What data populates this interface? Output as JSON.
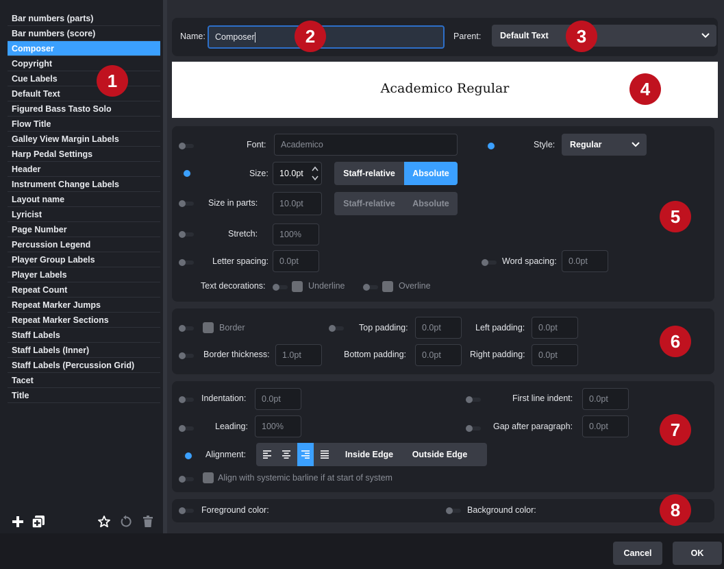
{
  "style_list": {
    "items": [
      "Bar numbers (parts)",
      "Bar numbers (score)",
      "Composer",
      "Copyright",
      "Cue Labels",
      "Default Text",
      "Figured Bass Tasto Solo",
      "Flow Title",
      "Galley View Margin Labels",
      "Harp Pedal Settings",
      "Header",
      "Instrument Change Labels",
      "Layout name",
      "Lyricist",
      "Page Number",
      "Percussion Legend",
      "Player Group Labels",
      "Player Labels",
      "Repeat Count",
      "Repeat Marker Jumps",
      "Repeat Marker Sections",
      "Staff Labels",
      "Staff Labels (Inner)",
      "Staff Labels (Percussion Grid)",
      "Tacet",
      "Title"
    ],
    "selected": "Composer"
  },
  "sidebar_tools": {
    "icons": [
      "plus-icon",
      "duplicate-icon",
      "star-icon",
      "reset-icon",
      "trash-icon"
    ]
  },
  "header": {
    "name_label": "Name:",
    "name_value": "Composer",
    "parent_label": "Parent:",
    "parent_value": "Default Text"
  },
  "preview": {
    "text": "Academico Regular"
  },
  "font_section": {
    "font_label": "Font:",
    "font_value": "Academico",
    "style_label": "Style:",
    "style_value": "Regular",
    "size_label": "Size:",
    "size_value": "10.0pt",
    "size_parts_label": "Size in parts:",
    "size_parts_value": "10.0pt",
    "staff_relative": "Staff-relative",
    "absolute": "Absolute",
    "stretch_label": "Stretch:",
    "stretch_value": "100%",
    "letter_spacing_label": "Letter spacing:",
    "letter_spacing_value": "0.0pt",
    "word_spacing_label": "Word spacing:",
    "word_spacing_value": "0.0pt",
    "decorations_label": "Text decorations:",
    "underline": "Underline",
    "overline": "Overline"
  },
  "border_section": {
    "border": "Border",
    "top_padding_label": "Top padding:",
    "top_padding_value": "0.0pt",
    "left_padding_label": "Left padding:",
    "left_padding_value": "0.0pt",
    "thickness_label": "Border thickness:",
    "thickness_value": "1.0pt",
    "bottom_padding_label": "Bottom padding:",
    "bottom_padding_value": "0.0pt",
    "right_padding_label": "Right padding:",
    "right_padding_value": "0.0pt"
  },
  "paragraph_section": {
    "indentation_label": "Indentation:",
    "indentation_value": "0.0pt",
    "first_line_label": "First line indent:",
    "first_line_value": "0.0pt",
    "leading_label": "Leading:",
    "leading_value": "100%",
    "gap_label": "Gap after paragraph:",
    "gap_value": "0.0pt",
    "alignment_label": "Alignment:",
    "inside_edge": "Inside Edge",
    "outside_edge": "Outside Edge",
    "selected_alignment": "right",
    "align_barline": "Align with systemic barline if at start of system"
  },
  "color_section": {
    "foreground_label": "Foreground color:",
    "background_label": "Background color:"
  },
  "callouts": [
    "1",
    "2",
    "3",
    "4",
    "5",
    "6",
    "7",
    "8"
  ],
  "footer": {
    "cancel": "Cancel",
    "ok": "OK"
  },
  "colors": {
    "accent": "#3ba0ff",
    "callout": "#c0121f",
    "panel": "#1f2127",
    "background": "#262830"
  }
}
